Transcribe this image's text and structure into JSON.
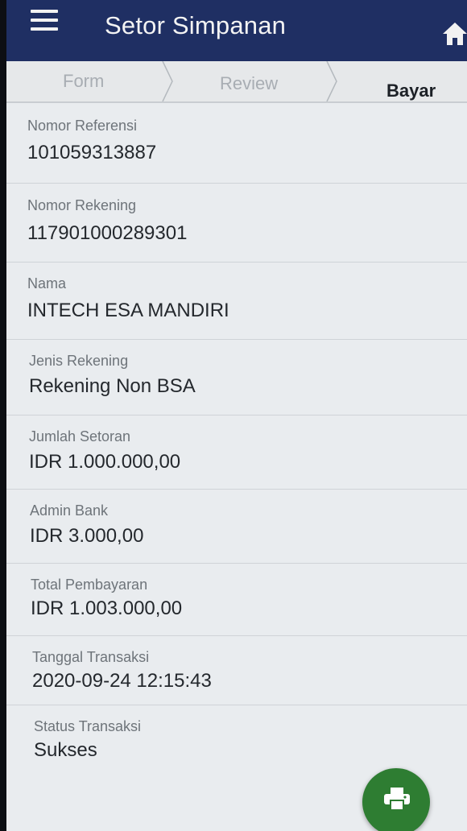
{
  "header": {
    "title": "Setor Simpanan"
  },
  "stepper": {
    "steps": [
      "Form",
      "Review",
      "Bayar"
    ]
  },
  "fields": [
    {
      "label": "Nomor Referensi",
      "value": "101059313887"
    },
    {
      "label": "Nomor Rekening",
      "value": "117901000289301"
    },
    {
      "label": "Nama",
      "value": "INTECH ESA MANDIRI"
    },
    {
      "label": "Jenis Rekening",
      "value": "Rekening Non BSA"
    },
    {
      "label": "Jumlah Setoran",
      "value": "IDR 1.000.000,00"
    },
    {
      "label": "Admin Bank",
      "value": "IDR 3.000,00"
    },
    {
      "label": "Total Pembayaran",
      "value": "IDR 1.003.000,00"
    },
    {
      "label": "Tanggal Transaksi",
      "value": "2020-09-24 12:15:43"
    },
    {
      "label": "Status Transaksi",
      "value": "Sukses"
    }
  ],
  "icons": {
    "menu": "hamburger-menu-icon",
    "home": "home-icon",
    "print": "print-icon"
  },
  "colors": {
    "header": "#1f2f63",
    "fab": "#2e7d32",
    "background": "#e9ecef"
  }
}
